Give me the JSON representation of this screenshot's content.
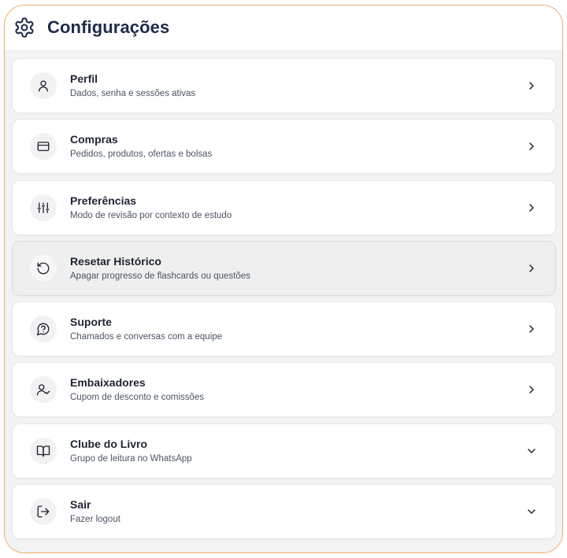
{
  "header": {
    "title": "Configurações",
    "icon": "gear-icon"
  },
  "items": [
    {
      "key": "perfil",
      "title": "Perfil",
      "subtitle": "Dados, senha e sessões ativas",
      "icon": "user-icon",
      "chevron": "right"
    },
    {
      "key": "compras",
      "title": "Compras",
      "subtitle": "Pedidos, produtos, ofertas e bolsas",
      "icon": "credit-card-icon",
      "chevron": "right"
    },
    {
      "key": "preferencias",
      "title": "Preferências",
      "subtitle": "Modo de revisão por contexto de estudo",
      "icon": "sliders-icon",
      "chevron": "right"
    },
    {
      "key": "resetar-historico",
      "title": "Resetar Histórico",
      "subtitle": "Apagar progresso de flashcards ou questões",
      "icon": "reset-icon",
      "chevron": "right",
      "active": true
    },
    {
      "key": "suporte",
      "title": "Suporte",
      "subtitle": "Chamados e conversas com a equipe",
      "icon": "help-chat-icon",
      "chevron": "right"
    },
    {
      "key": "embaixadores",
      "title": "Embaixadores",
      "subtitle": "Cupom de desconto e comissões",
      "icon": "user-check-icon",
      "chevron": "right"
    },
    {
      "key": "clube-do-livro",
      "title": "Clube do Livro",
      "subtitle": "Grupo de leitura no WhatsApp",
      "icon": "book-open-icon",
      "chevron": "down"
    },
    {
      "key": "sair",
      "title": "Sair",
      "subtitle": "Fazer logout",
      "icon": "logout-icon",
      "chevron": "down"
    }
  ],
  "colors": {
    "frame_border": "#f0a866",
    "title": "#1e2b4a",
    "list_bg": "#f3f3f3",
    "active_bg": "#efefef"
  }
}
